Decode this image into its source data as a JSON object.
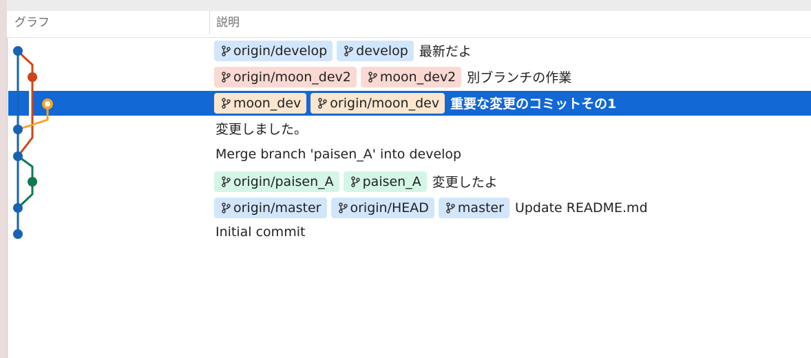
{
  "header": {
    "graph_label": "グラフ",
    "description_label": "説明"
  },
  "colors": {
    "selection": "#1268d4",
    "lane_blue": "#1763b5",
    "lane_red": "#d14319",
    "lane_orange": "#f6a326",
    "lane_green": "#0f7a4d"
  },
  "commits": [
    {
      "message": "最新だよ",
      "refs": [
        {
          "label": "origin/develop",
          "color": "blue",
          "icon": "branch-icon"
        },
        {
          "label": "develop",
          "color": "blue",
          "icon": "branch-icon"
        }
      ]
    },
    {
      "message": "別ブランチの作業",
      "refs": [
        {
          "label": "origin/moon_dev2",
          "color": "red",
          "icon": "branch-icon"
        },
        {
          "label": "moon_dev2",
          "color": "red",
          "icon": "branch-icon"
        }
      ]
    },
    {
      "message": "重要な変更のコミットその1",
      "selected": true,
      "refs": [
        {
          "label": "moon_dev",
          "color": "orange",
          "icon": "branch-icon"
        },
        {
          "label": "origin/moon_dev",
          "color": "orange",
          "icon": "branch-icon"
        }
      ]
    },
    {
      "message": "変更しました。",
      "refs": []
    },
    {
      "message": "Merge branch 'paisen_A' into develop",
      "refs": []
    },
    {
      "message": "変更したよ",
      "refs": [
        {
          "label": "origin/paisen_A",
          "color": "green",
          "icon": "branch-icon"
        },
        {
          "label": "paisen_A",
          "color": "green",
          "icon": "branch-icon"
        }
      ]
    },
    {
      "message": "Update README.md",
      "refs": [
        {
          "label": "origin/master",
          "color": "blue",
          "icon": "branch-icon"
        },
        {
          "label": "origin/HEAD",
          "color": "blue",
          "icon": "branch-icon"
        },
        {
          "label": "master",
          "color": "blue",
          "icon": "branch-icon"
        }
      ]
    },
    {
      "message": "Initial commit",
      "refs": []
    }
  ]
}
